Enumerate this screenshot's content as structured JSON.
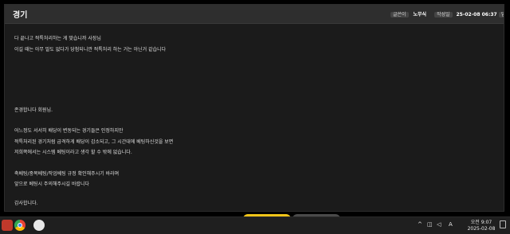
{
  "window": {
    "title": "경기",
    "meta": [
      {
        "label": "글쓴이",
        "value": "노무식"
      },
      {
        "label": "작성일",
        "value": "25-02-08 06:37"
      },
      {
        "label": "답",
        "value": ""
      }
    ]
  },
  "post": {
    "lines": [
      "다 끝나고 적특처리하는 게 맞습니까 사장님",
      "이길 때는 아무 말도 없다가 당첨되니깐 적특처리 하는 거는 아닌거 같습니다",
      "존경합니다 회원님.",
      "어느정도 서서히 배당이 변동되는 경기들은 인정하지만",
      "적특처리된 경기처럼 급격하게 배당이 감소되고, 그 시간대에 베팅하신것을 보면",
      "저희쪽에서는 시스템 베팅이라고 생각 할 수 밖에 없습니다.",
      "축베팅/중복베팅/작업베팅 규정 확인해주시기 바라며",
      "앞으로 베팅시 주의해주시길 바랍니다",
      "감사합니다."
    ]
  },
  "taskbar": {
    "tray_text": "A",
    "time": "오전 9:07",
    "date": "2025-02-08"
  },
  "colors": {
    "accent": "#f0c419",
    "panel": "#1b1b1b",
    "header": "#2e2e2e"
  }
}
